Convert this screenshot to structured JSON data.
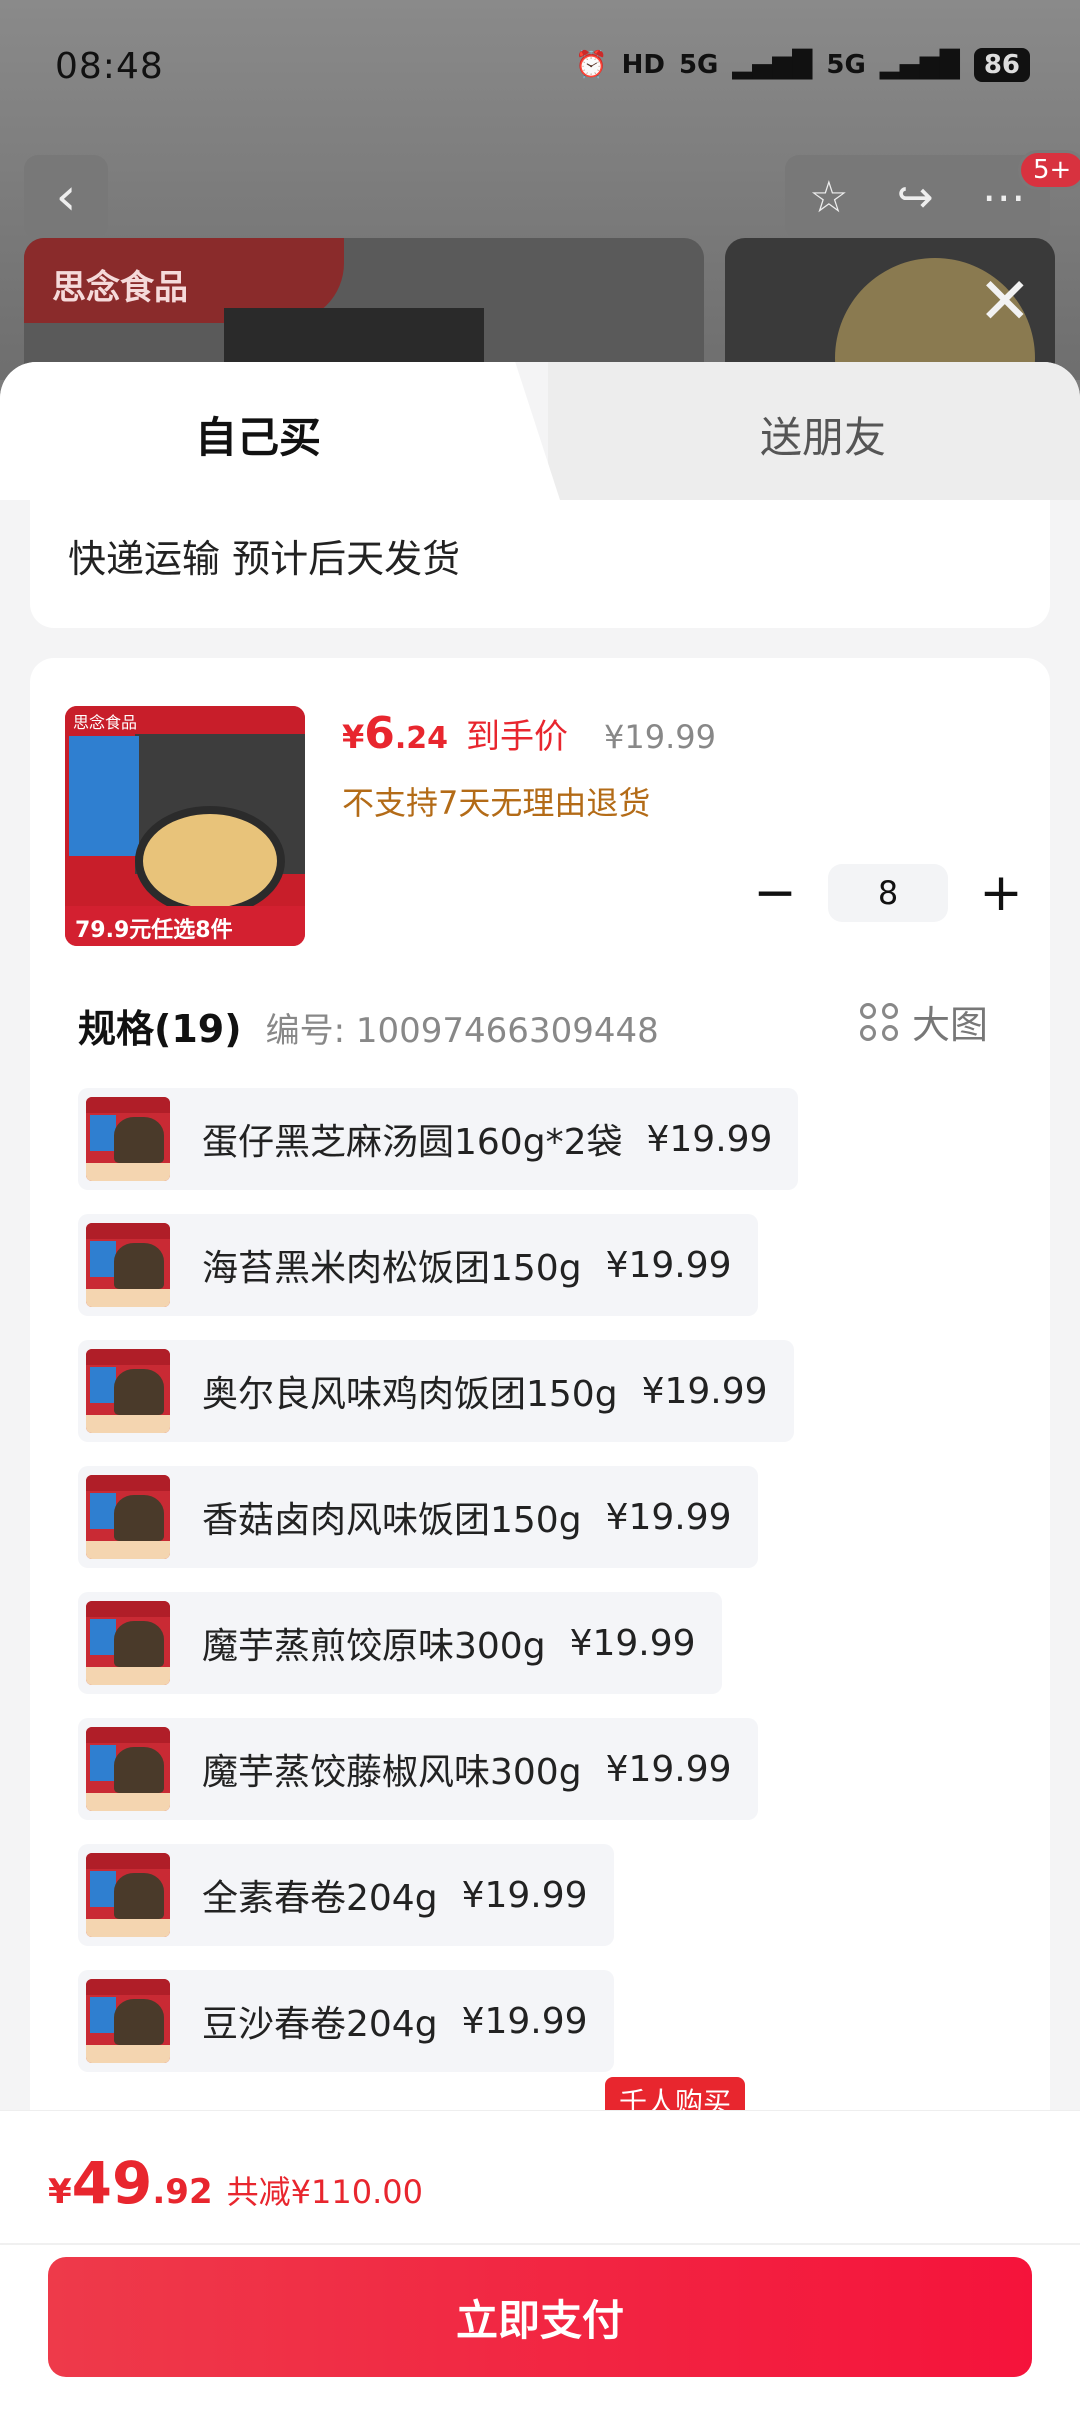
{
  "status_bar": {
    "time": "08:48",
    "hd_label": "HD",
    "net1": "5G",
    "net2": "5G",
    "battery": "86"
  },
  "top_bar": {
    "back_icon": "chevron-left-icon",
    "notification_badge": "5+"
  },
  "banner": {
    "brand_text": "思念食品"
  },
  "tabs": [
    {
      "label": "自己买",
      "active": true
    },
    {
      "label": "送朋友",
      "active": false
    }
  ],
  "shipping": {
    "text": "快递运输 预计后天发货"
  },
  "product": {
    "price_symbol": "¥",
    "price_int": "6",
    "price_dec": ".24",
    "price_tag": "到手价",
    "original_price": "¥19.99",
    "return_policy": "不支持7天无理由退货",
    "image_top_text": "思念食品",
    "image_bottom_text": "79.9元任选8件"
  },
  "stepper": {
    "minus": "−",
    "value": "8",
    "plus": "+"
  },
  "specs": {
    "title": "规格(19)",
    "code": "编号: 10097466309448",
    "big_image_label": "大图",
    "items": [
      {
        "name": "蛋仔黑芝麻汤圆160g*2袋",
        "price": "¥19.99"
      },
      {
        "name": "海苔黑米肉松饭团150g",
        "price": "¥19.99"
      },
      {
        "name": "奥尔良风味鸡肉饭团150g",
        "price": "¥19.99"
      },
      {
        "name": "香菇卤肉风味饭团150g",
        "price": "¥19.99"
      },
      {
        "name": "魔芋蒸煎饺原味300g",
        "price": "¥19.99"
      },
      {
        "name": "魔芋蒸饺藤椒风味300g",
        "price": "¥19.99"
      },
      {
        "name": "全素春卷204g",
        "price": "¥19.99"
      },
      {
        "name": "豆沙春卷204g",
        "price": "¥19.99"
      }
    ],
    "hot_tag": "千人购买"
  },
  "footer": {
    "total_symbol": "¥",
    "total_int": "49",
    "total_dec": ".92",
    "saved_text": "共减¥110.00",
    "pay_button": "立即支付"
  },
  "colors": {
    "accent_red": "#e8262e",
    "warning_brown": "#b36b17"
  }
}
